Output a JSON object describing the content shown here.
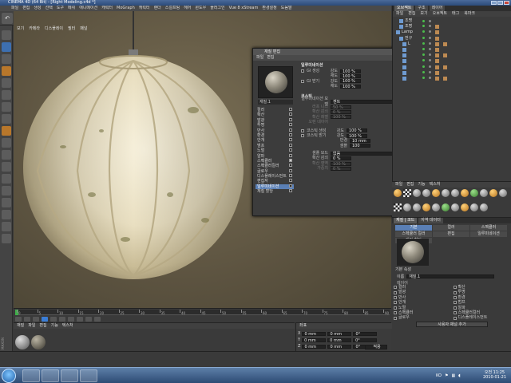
{
  "window": {
    "title": "CINEMA 4D (64 Bit) - [Right Modeling.c4d *]"
  },
  "menubar": [
    "파일",
    "편집",
    "생성",
    "선택",
    "도구",
    "메쉬",
    "애니메이션",
    "캐릭터",
    "MoGraph",
    "캐릭터",
    "렌더",
    "스컬프팅",
    "헤어",
    "윈도우",
    "플러그인",
    "Vue 8 xStream",
    "환경설정",
    "도움말"
  ],
  "viewport": {
    "menu": [
      "보기",
      "카메라",
      "디스플레이",
      "필터",
      "패널"
    ]
  },
  "material_editor": {
    "title": "재질 편집",
    "menu": [
      "파일",
      "편집"
    ],
    "material_name": "재질.1",
    "channels": [
      {
        "label": "컬러",
        "checked": false
      },
      {
        "label": "확산",
        "checked": false
      },
      {
        "label": "발광",
        "checked": false
      },
      {
        "label": "투명",
        "checked": false
      },
      {
        "label": "반사",
        "checked": false
      },
      {
        "label": "환경",
        "checked": false
      },
      {
        "label": "안개",
        "checked": false
      },
      {
        "label": "범프",
        "checked": false
      },
      {
        "label": "노멀",
        "checked": false
      },
      {
        "label": "알파",
        "checked": false
      },
      {
        "label": "스펙큘러",
        "checked": true
      },
      {
        "label": "스펙큘러컬러",
        "checked": false
      },
      {
        "label": "글로우",
        "checked": false
      },
      {
        "label": "디스플레이스먼트",
        "checked": false
      },
      {
        "label": "편집자",
        "checked": false
      },
      {
        "label": "일루미네이션",
        "checked": false
      },
      {
        "label": "재질 할당",
        "checked": false
      }
    ],
    "selected_channel": "일루미네이션",
    "sections": {
      "global_illum": "일루미네이션",
      "gi_generate_label": "GI 생성",
      "gi_receive_label": "GI 받기",
      "strength_label": "강도",
      "saturation_label": "채도",
      "gi_gen_strength": "100 %",
      "gi_gen_saturation": "100 %",
      "gi_rec_strength": "100 %",
      "gi_rec_saturation": "100 %",
      "caustics": "코스틱",
      "illum_model_label": "일루미네이션 모델",
      "illum_model_value": "젠트",
      "rough_label": "러프 니스",
      "rough_value": "50 %",
      "dif_falloff_label": "확산 감쇠",
      "dif_falloff_value": "0 %",
      "dif_level_label": "확산 레벨",
      "dif_level_value": "100 %",
      "orennayar_label": "오렌 네이어",
      "photon_gen_label": "코스틱 생성",
      "photon_rec_label": "코스틱 받기",
      "photon_strength_label": "강도",
      "photon_strength": "100 %",
      "photon_rec_strength": "100 %",
      "radius_label": "반경",
      "radius_value": "10 mm",
      "samples_label": "샘플",
      "samples_value": "100",
      "sample_mode_label": "샘플 모드",
      "sample_mode_value": "없음",
      "coverage_label": "확산 감쇠",
      "coverage_value": "0 %",
      "tone_label": "확산 영역",
      "tone_value": "100 %",
      "tone2_label": "가중치",
      "tone2_value": "0 %"
    }
  },
  "object_manager": {
    "tabs": [
      "오브젝트",
      "구조",
      "레이어"
    ],
    "menu": [
      "파일",
      "편집",
      "보기",
      "오브젝트",
      "태그",
      "북마크"
    ],
    "rows": [
      {
        "label": "조명",
        "selected": false,
        "indent": 1
      },
      {
        "label": "조명",
        "selected": false,
        "indent": 1
      },
      {
        "label": "Lamp",
        "selected": false,
        "indent": 0
      },
      {
        "label": "전구",
        "selected": false,
        "indent": 1
      },
      {
        "label": "L",
        "selected": false,
        "indent": 2
      },
      {
        "label": "",
        "selected": false,
        "indent": 2
      },
      {
        "label": "",
        "selected": false,
        "indent": 2
      },
      {
        "label": "",
        "selected": false,
        "indent": 2
      },
      {
        "label": "",
        "selected": false,
        "indent": 2
      },
      {
        "label": "",
        "selected": false,
        "indent": 2
      },
      {
        "label": "",
        "selected": false,
        "indent": 2
      }
    ]
  },
  "material_manager": {
    "menu": [
      "파일",
      "편집",
      "기능",
      "텍스처"
    ],
    "tabs": [
      "재질",
      "Ut"
    ]
  },
  "attribute_manager": {
    "tabs": [
      "재질 | 코드",
      "자역 데이터"
    ],
    "subtabs": [
      "기본",
      "컬러",
      "스펙큘러",
      "스펙큘러 컬러",
      "편집",
      "일루미네이션",
      "재질 할당"
    ],
    "basic_label": "기본 속성",
    "name_label": "이름",
    "name_value": "재질.1",
    "layer_label": "레이어",
    "channels": [
      "컬러",
      "확산",
      "발광",
      "투명",
      "반사",
      "환경",
      "안개",
      "범프",
      "노멀",
      "알파",
      "스펙큘러",
      "스펙큘러컬러",
      "글로우",
      "디스플레이스먼트"
    ],
    "button": "사용자 채널 추가"
  },
  "timeline": {
    "ticks": [
      "0",
      "5",
      "10",
      "15",
      "20",
      "25",
      "30",
      "35",
      "40",
      "45",
      "50",
      "55",
      "60",
      "65",
      "70",
      "75",
      "80",
      "85",
      "90"
    ]
  },
  "material_bar": {
    "menu": [
      "재질",
      "파일",
      "편집",
      "기능",
      "텍스처"
    ]
  },
  "coordinates": {
    "title": "좌표",
    "rows": [
      {
        "axis": "X",
        "pos": "0 mm",
        "size": "0 mm",
        "rot": "0°"
      },
      {
        "axis": "Y",
        "pos": "0 mm",
        "size": "0 mm",
        "rot": "0°"
      },
      {
        "axis": "Z",
        "pos": "0 mm",
        "size": "0 mm",
        "rot": "0°"
      }
    ],
    "apply": "적용"
  },
  "taskbar": {
    "lang": "KO",
    "time": "오전 11:25",
    "date": "2010-01-21"
  },
  "colors": {
    "accent": "#5a7fb5",
    "dialog_bg": "#3c3c3c",
    "panel_bg": "#3a3a3a"
  }
}
